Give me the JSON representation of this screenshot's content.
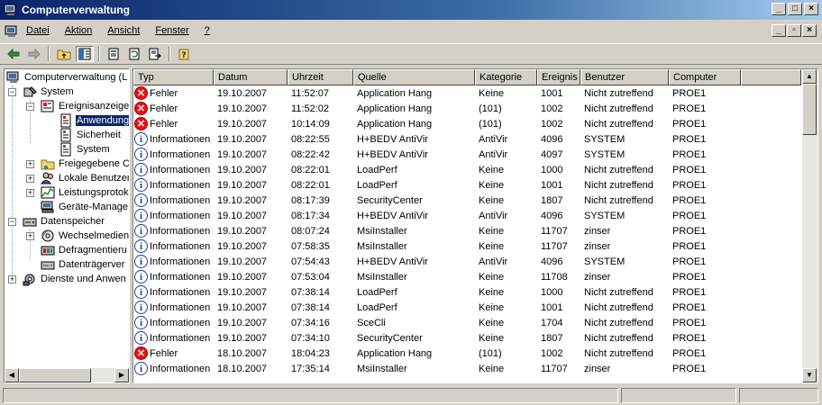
{
  "window": {
    "title": "Computerverwaltung",
    "buttons": [
      "_",
      "□",
      "×"
    ]
  },
  "menu": {
    "items": [
      "Datei",
      "Aktion",
      "Ansicht",
      "Fenster",
      "?"
    ],
    "child_buttons": [
      "_",
      "▫",
      "×"
    ]
  },
  "toolbar": {
    "icons": [
      "back-icon",
      "forward-icon",
      "up-folder-icon",
      "show-tree-icon",
      "properties-icon",
      "refresh-icon",
      "export-icon",
      "help-icon"
    ]
  },
  "tree": {
    "items": [
      {
        "label": "Computerverwaltung (L",
        "icon": "computer-management-icon"
      },
      {
        "label": "System",
        "icon": "system-tools-icon"
      },
      {
        "label": "Ereignisanzeige",
        "icon": "event-viewer-icon"
      },
      {
        "label": "Anwendung",
        "icon": "log-icon"
      },
      {
        "label": "Sicherheit",
        "icon": "log-icon"
      },
      {
        "label": "System",
        "icon": "log-icon"
      },
      {
        "label": "Freigegebene C",
        "icon": "shared-folder-icon"
      },
      {
        "label": "Lokale Benutzer",
        "icon": "users-icon"
      },
      {
        "label": "Leistungsprotok",
        "icon": "performance-icon"
      },
      {
        "label": "Geräte-Manage",
        "icon": "device-manager-icon"
      },
      {
        "label": "Datenspeicher",
        "icon": "storage-icon"
      },
      {
        "label": "Wechselmedien",
        "icon": "removable-media-icon"
      },
      {
        "label": "Defragmentieru",
        "icon": "defrag-icon"
      },
      {
        "label": "Datenträgerver",
        "icon": "disk-management-icon"
      },
      {
        "label": "Dienste und Anwen",
        "icon": "services-icon"
      }
    ]
  },
  "columns": [
    "Typ",
    "Datum",
    "Uhrzeit",
    "Quelle",
    "Kategorie",
    "Ereignis",
    "Benutzer",
    "Computer"
  ],
  "rows": [
    {
      "type": "error",
      "typ": "Fehler",
      "datum": "19.10.2007",
      "uhrzeit": "11:52:07",
      "quelle": "Application Hang",
      "kategorie": "Keine",
      "ereignis": "1001",
      "benutzer": "Nicht zutreffend",
      "computer": "PROE1"
    },
    {
      "type": "error",
      "typ": "Fehler",
      "datum": "19.10.2007",
      "uhrzeit": "11:52:02",
      "quelle": "Application Hang",
      "kategorie": "(101)",
      "ereignis": "1002",
      "benutzer": "Nicht zutreffend",
      "computer": "PROE1"
    },
    {
      "type": "error",
      "typ": "Fehler",
      "datum": "19.10.2007",
      "uhrzeit": "10:14:09",
      "quelle": "Application Hang",
      "kategorie": "(101)",
      "ereignis": "1002",
      "benutzer": "Nicht zutreffend",
      "computer": "PROE1"
    },
    {
      "type": "info",
      "typ": "Informationen",
      "datum": "19.10.2007",
      "uhrzeit": "08:22:55",
      "quelle": "H+BEDV AntiVir",
      "kategorie": "AntiVir",
      "ereignis": "4096",
      "benutzer": "SYSTEM",
      "computer": "PROE1"
    },
    {
      "type": "info",
      "typ": "Informationen",
      "datum": "19.10.2007",
      "uhrzeit": "08:22:42",
      "quelle": "H+BEDV AntiVir",
      "kategorie": "AntiVir",
      "ereignis": "4097",
      "benutzer": "SYSTEM",
      "computer": "PROE1"
    },
    {
      "type": "info",
      "typ": "Informationen",
      "datum": "19.10.2007",
      "uhrzeit": "08:22:01",
      "quelle": "LoadPerf",
      "kategorie": "Keine",
      "ereignis": "1000",
      "benutzer": "Nicht zutreffend",
      "computer": "PROE1"
    },
    {
      "type": "info",
      "typ": "Informationen",
      "datum": "19.10.2007",
      "uhrzeit": "08:22:01",
      "quelle": "LoadPerf",
      "kategorie": "Keine",
      "ereignis": "1001",
      "benutzer": "Nicht zutreffend",
      "computer": "PROE1"
    },
    {
      "type": "info",
      "typ": "Informationen",
      "datum": "19.10.2007",
      "uhrzeit": "08:17:39",
      "quelle": "SecurityCenter",
      "kategorie": "Keine",
      "ereignis": "1807",
      "benutzer": "Nicht zutreffend",
      "computer": "PROE1"
    },
    {
      "type": "info",
      "typ": "Informationen",
      "datum": "19.10.2007",
      "uhrzeit": "08:17:34",
      "quelle": "H+BEDV AntiVir",
      "kategorie": "AntiVir",
      "ereignis": "4096",
      "benutzer": "SYSTEM",
      "computer": "PROE1"
    },
    {
      "type": "info",
      "typ": "Informationen",
      "datum": "19.10.2007",
      "uhrzeit": "08:07:24",
      "quelle": "MsiInstaller",
      "kategorie": "Keine",
      "ereignis": "11707",
      "benutzer": "zinser",
      "computer": "PROE1"
    },
    {
      "type": "info",
      "typ": "Informationen",
      "datum": "19.10.2007",
      "uhrzeit": "07:58:35",
      "quelle": "MsiInstaller",
      "kategorie": "Keine",
      "ereignis": "11707",
      "benutzer": "zinser",
      "computer": "PROE1"
    },
    {
      "type": "info",
      "typ": "Informationen",
      "datum": "19.10.2007",
      "uhrzeit": "07:54:43",
      "quelle": "H+BEDV AntiVir",
      "kategorie": "AntiVir",
      "ereignis": "4096",
      "benutzer": "SYSTEM",
      "computer": "PROE1"
    },
    {
      "type": "info",
      "typ": "Informationen",
      "datum": "19.10.2007",
      "uhrzeit": "07:53:04",
      "quelle": "MsiInstaller",
      "kategorie": "Keine",
      "ereignis": "11708",
      "benutzer": "zinser",
      "computer": "PROE1"
    },
    {
      "type": "info",
      "typ": "Informationen",
      "datum": "19.10.2007",
      "uhrzeit": "07:38:14",
      "quelle": "LoadPerf",
      "kategorie": "Keine",
      "ereignis": "1000",
      "benutzer": "Nicht zutreffend",
      "computer": "PROE1"
    },
    {
      "type": "info",
      "typ": "Informationen",
      "datum": "19.10.2007",
      "uhrzeit": "07:38:14",
      "quelle": "LoadPerf",
      "kategorie": "Keine",
      "ereignis": "1001",
      "benutzer": "Nicht zutreffend",
      "computer": "PROE1"
    },
    {
      "type": "info",
      "typ": "Informationen",
      "datum": "19.10.2007",
      "uhrzeit": "07:34:16",
      "quelle": "SceCli",
      "kategorie": "Keine",
      "ereignis": "1704",
      "benutzer": "Nicht zutreffend",
      "computer": "PROE1"
    },
    {
      "type": "info",
      "typ": "Informationen",
      "datum": "19.10.2007",
      "uhrzeit": "07:34:10",
      "quelle": "SecurityCenter",
      "kategorie": "Keine",
      "ereignis": "1807",
      "benutzer": "Nicht zutreffend",
      "computer": "PROE1"
    },
    {
      "type": "error",
      "typ": "Fehler",
      "datum": "18.10.2007",
      "uhrzeit": "18:04:23",
      "quelle": "Application Hang",
      "kategorie": "(101)",
      "ereignis": "1002",
      "benutzer": "Nicht zutreffend",
      "computer": "PROE1"
    },
    {
      "type": "info",
      "typ": "Informationen",
      "datum": "18.10.2007",
      "uhrzeit": "17:35:14",
      "quelle": "MsiInstaller",
      "kategorie": "Keine",
      "ereignis": "11707",
      "benutzer": "zinser",
      "computer": "PROE1"
    }
  ],
  "colors": {
    "title_start": "#0a246a",
    "title_end": "#a6caf0",
    "selection": "#0a246a",
    "error": "#e11111",
    "info": "#1c3f94",
    "face": "#d4d0c8"
  }
}
